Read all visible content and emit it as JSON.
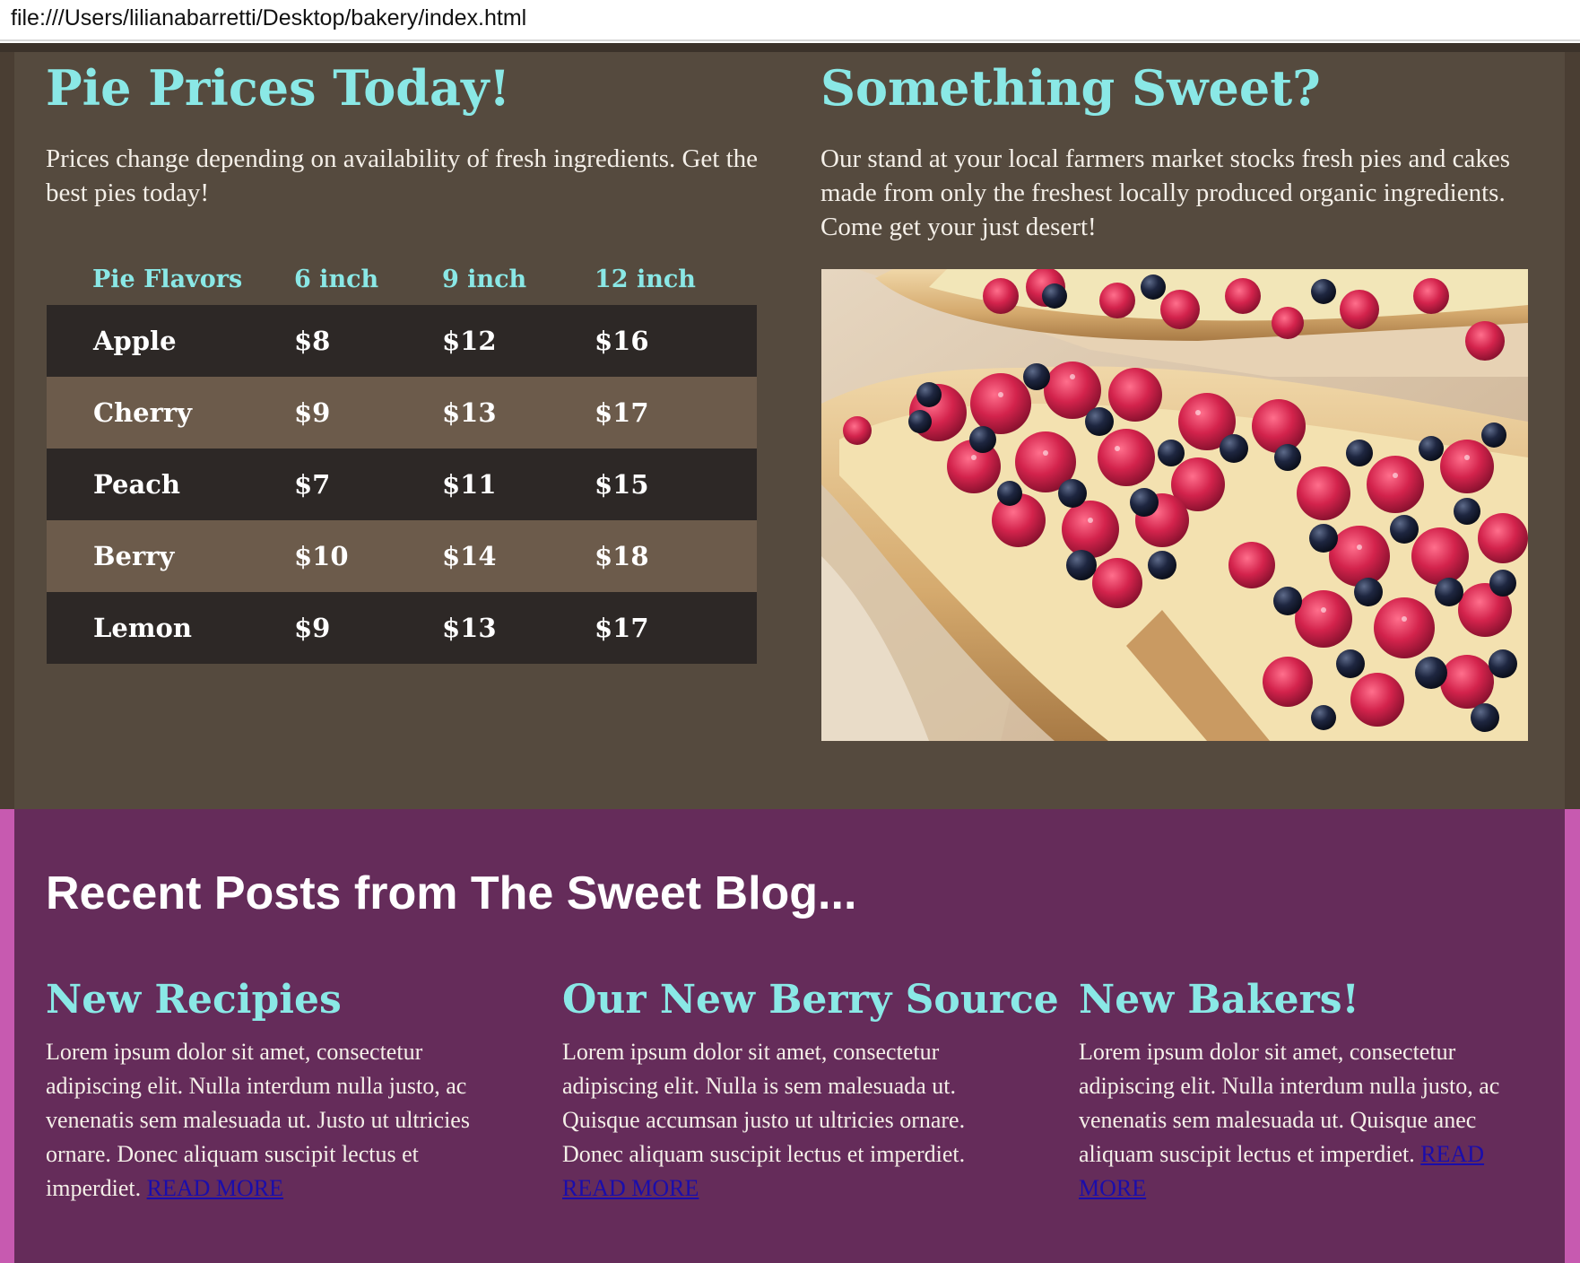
{
  "browser": {
    "url": "file:///Users/lilianabarretti/Desktop/bakery/index.html"
  },
  "prices_section": {
    "title": "Pie Prices Today!",
    "intro": "Prices change depending on availability of fresh ingredients. Get the best pies today!",
    "table": {
      "headers": [
        "Pie Flavors",
        "6 inch",
        "9 inch",
        "12 inch"
      ],
      "rows": [
        [
          "Apple",
          "$8",
          "$12",
          "$16"
        ],
        [
          "Cherry",
          "$9",
          "$13",
          "$17"
        ],
        [
          "Peach",
          "$7",
          "$11",
          "$15"
        ],
        [
          "Berry",
          "$10",
          "$14",
          "$18"
        ],
        [
          "Lemon",
          "$9",
          "$13",
          "$17"
        ]
      ]
    }
  },
  "sweet_section": {
    "title": "Something Sweet?",
    "intro": "Our stand at your local farmers market stocks fresh pies and cakes made from only the freshest locally produced organic ingredients. Come get your just desert!"
  },
  "blog_section": {
    "title": "Recent Posts from The Sweet Blog...",
    "posts": [
      {
        "title": "New Recipies",
        "body": "Lorem ipsum dolor sit amet, consectetur adipiscing elit. Nulla interdum nulla justo, ac venenatis sem malesuada ut. Justo ut ultricies ornare. Donec aliquam suscipit lectus et imperdiet.",
        "link": "READ MORE"
      },
      {
        "title": "Our New Berry Source",
        "body": "Lorem ipsum dolor sit amet, consectetur adipiscing elit. Nulla is sem malesuada ut. Quisque accumsan justo ut ultricies ornare. Donec aliquam suscipit lectus et imperdiet.",
        "link": "READ MORE"
      },
      {
        "title": "New Bakers!",
        "body": "Lorem ipsum dolor sit amet, consectetur adipiscing elit. Nulla interdum nulla justo, ac venenatis sem malesuada ut. Quisque anec aliquam suscipit lectus et imperdiet.",
        "link": "READ MORE"
      }
    ]
  },
  "colors": {
    "brown_bg": "#554a3e",
    "purple_bg": "#652c5a",
    "accent": "#8ae8e6",
    "row_dark": "#2d2826",
    "row_light": "#6c5b4b"
  }
}
